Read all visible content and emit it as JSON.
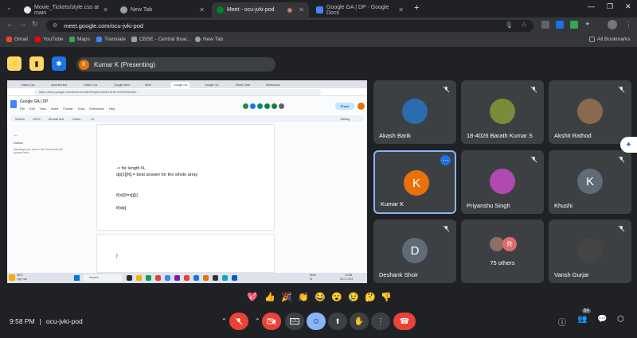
{
  "tabs": [
    {
      "label": "Movie_Tickets/style.css at main",
      "color": "#e8eaed"
    },
    {
      "label": "New Tab",
      "color": "#9aa0a6"
    },
    {
      "label": "Meet - ocu-jvki-pod",
      "color": "#00832d"
    },
    {
      "label": "Google GA | DP - Google Docs",
      "color": "#4285f4"
    }
  ],
  "address": {
    "url": "meet.google.com/ocu-jvki-pod"
  },
  "bookmarks": [
    {
      "label": "Gmail",
      "color": "#ea4335"
    },
    {
      "label": "YouTube",
      "color": "#ff0000"
    },
    {
      "label": "Maps",
      "color": "#34a853"
    },
    {
      "label": "Translate",
      "color": "#4285f4"
    },
    {
      "label": "CBSE - Central Boar...",
      "color": "#9aa0a6"
    },
    {
      "label": "New Tab",
      "color": "#9aa0a6"
    },
    {
      "label": "All Bookmarks",
      "color": "#9aa0a6"
    }
  ],
  "presenting": {
    "initial": "K",
    "label": "Kumar K (Presenting)"
  },
  "shared_screen": {
    "doc_title": "Google GA | DP",
    "doc_url": "https://docs.google.com/document/d/1RtmpleUnEk0-8HS-b0Hr5V5bZMz...",
    "menu": [
      "File",
      "Edit",
      "View",
      "Insert",
      "Format",
      "Tools",
      "Extensions",
      "Help"
    ],
    "zoom": "100%",
    "style": "Normal text",
    "font": "Comic...",
    "font_size": "11",
    "editing": "Editing",
    "outline_heading": "Outline",
    "outline_hint": "Headings you add to the document will appear here.",
    "share_label": "Share",
    "code_lines": [
      "-> for length N,",
      "dp[1][N] = best answer for the whole array",
      "if(x[i]!=x[j]){",
      "if(dp[",
      "}"
    ],
    "search_placeholder": "Search",
    "weather": "28°C",
    "weather_sub": "Light rain",
    "clock": "14:58",
    "date": "08-07-2024",
    "lang": "ENG",
    "lang_sub": "IN"
  },
  "participants": [
    {
      "name": "Akash Barik",
      "initial": "",
      "bg": "#2b6cb0"
    },
    {
      "name": "18-4026 Barath Kumar S",
      "initial": "",
      "bg": "#7b8b3a"
    },
    {
      "name": "Akshit Rathod",
      "initial": "",
      "bg": "#8a6a4f"
    },
    {
      "name": "Kumar K",
      "initial": "K",
      "bg": "#e8710a"
    },
    {
      "name": "Priyanshu Singh",
      "initial": "",
      "bg": "#b04ab0"
    },
    {
      "name": "Khushi",
      "initial": "K",
      "bg": "#5f6b77"
    },
    {
      "name": "Deshank Shoir",
      "initial": "D",
      "bg": "#5f6b77"
    },
    {
      "name": "75 others",
      "initial": "R",
      "bg": "#e06c6c"
    },
    {
      "name": "Vansh Gurjar",
      "initial": "",
      "bg": "#444"
    }
  ],
  "reactions": [
    "💖",
    "👍",
    "🎉",
    "👏",
    "😂",
    "😮",
    "😢",
    "🤔",
    "👎"
  ],
  "footer": {
    "time": "9:58 PM",
    "separator": "|",
    "meeting_code": "ocu-jvki-pod",
    "people_count": "84"
  }
}
